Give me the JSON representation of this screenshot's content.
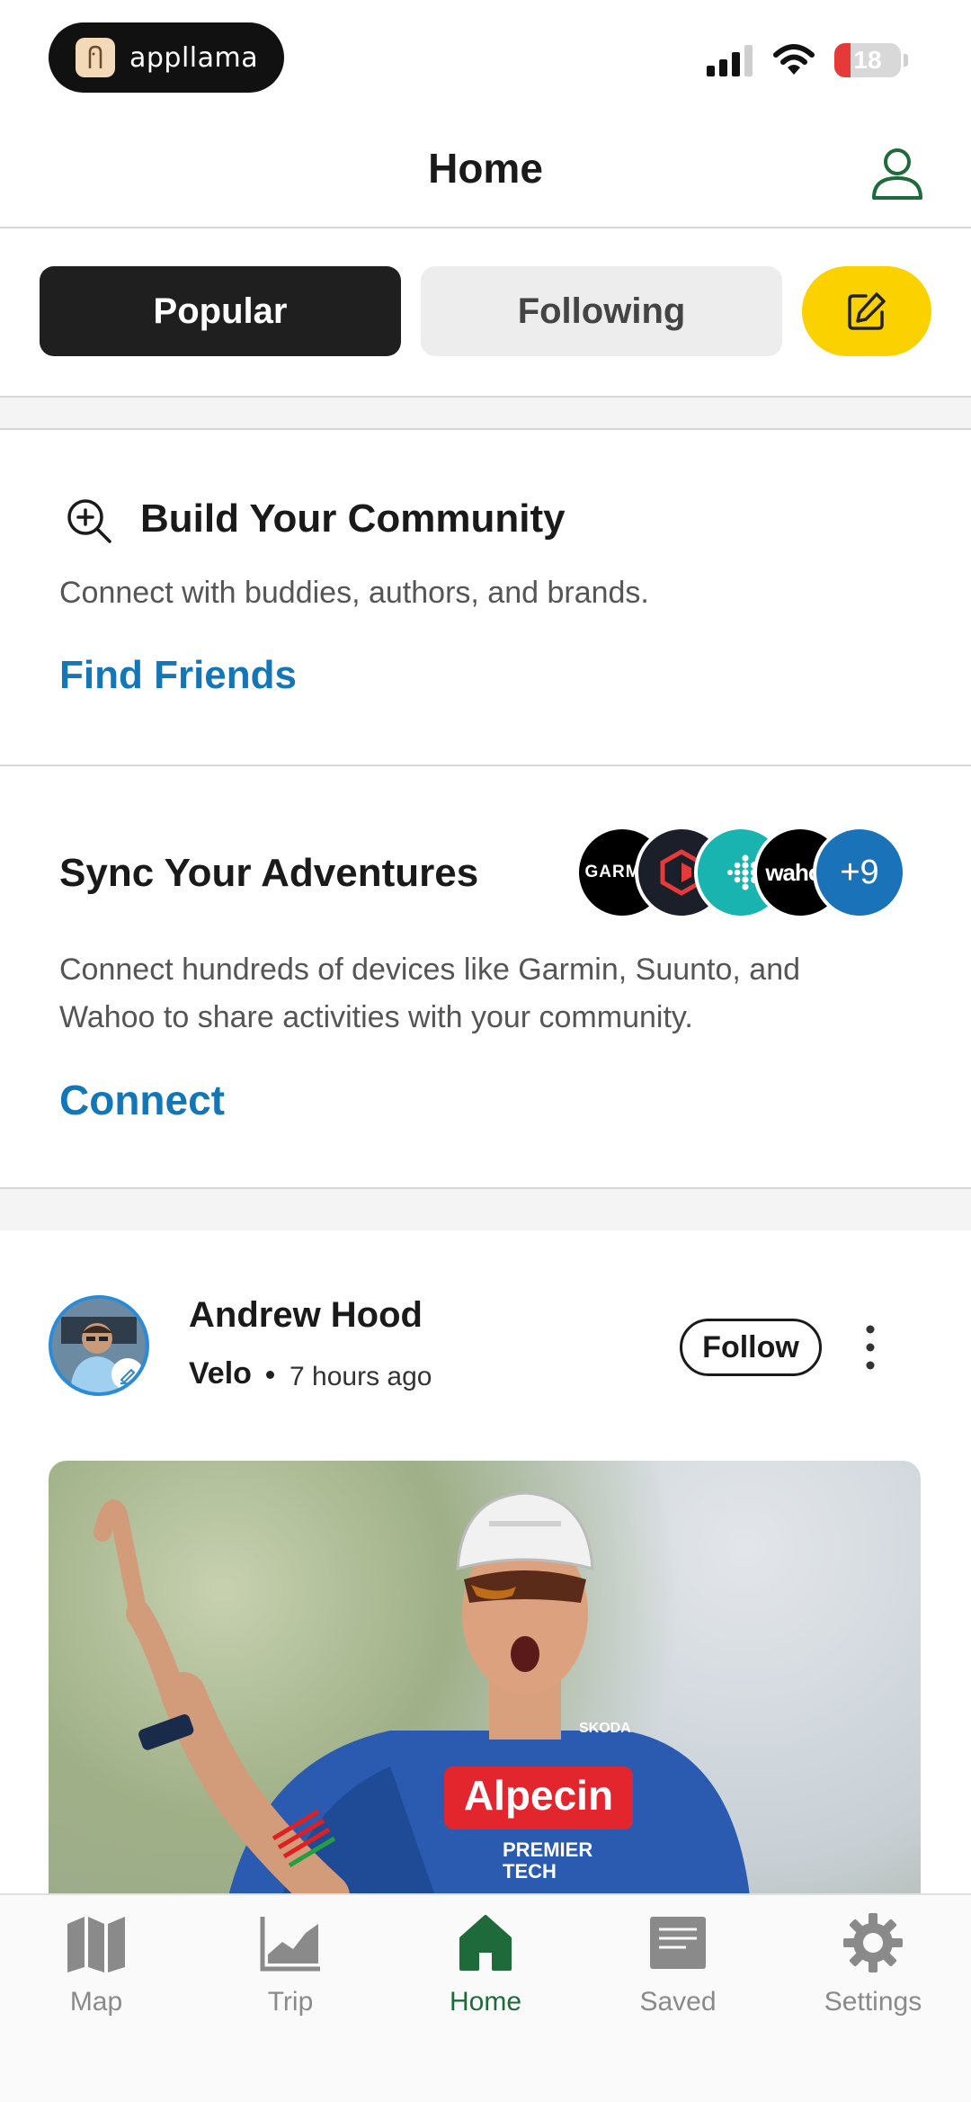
{
  "status_bar": {
    "app_name": "appllama",
    "battery": "18"
  },
  "header": {
    "title": "Home"
  },
  "tabs": {
    "popular": "Popular",
    "following": "Following"
  },
  "community_card": {
    "title": "Build Your Community",
    "subtitle": "Connect with buddies, authors, and brands.",
    "link": "Find Friends"
  },
  "sync_card": {
    "title": "Sync Your Adventures",
    "subtitle": "Connect hundreds of devices like Garmin, Suunto, and Wahoo to share activities with your community.",
    "link": "Connect",
    "brands": [
      "GARMIN",
      "wahoo",
      "+9"
    ]
  },
  "post": {
    "author": "Andrew Hood",
    "source": "Velo",
    "time": "7 hours ago",
    "follow_label": "Follow"
  },
  "bottom_nav": {
    "items": [
      {
        "label": "Map"
      },
      {
        "label": "Trip"
      },
      {
        "label": "Home"
      },
      {
        "label": "Saved"
      },
      {
        "label": "Settings"
      }
    ]
  },
  "colors": {
    "accent_blue": "#1376b7",
    "accent_yellow": "#fcd100",
    "active_green": "#1e6a3a"
  }
}
